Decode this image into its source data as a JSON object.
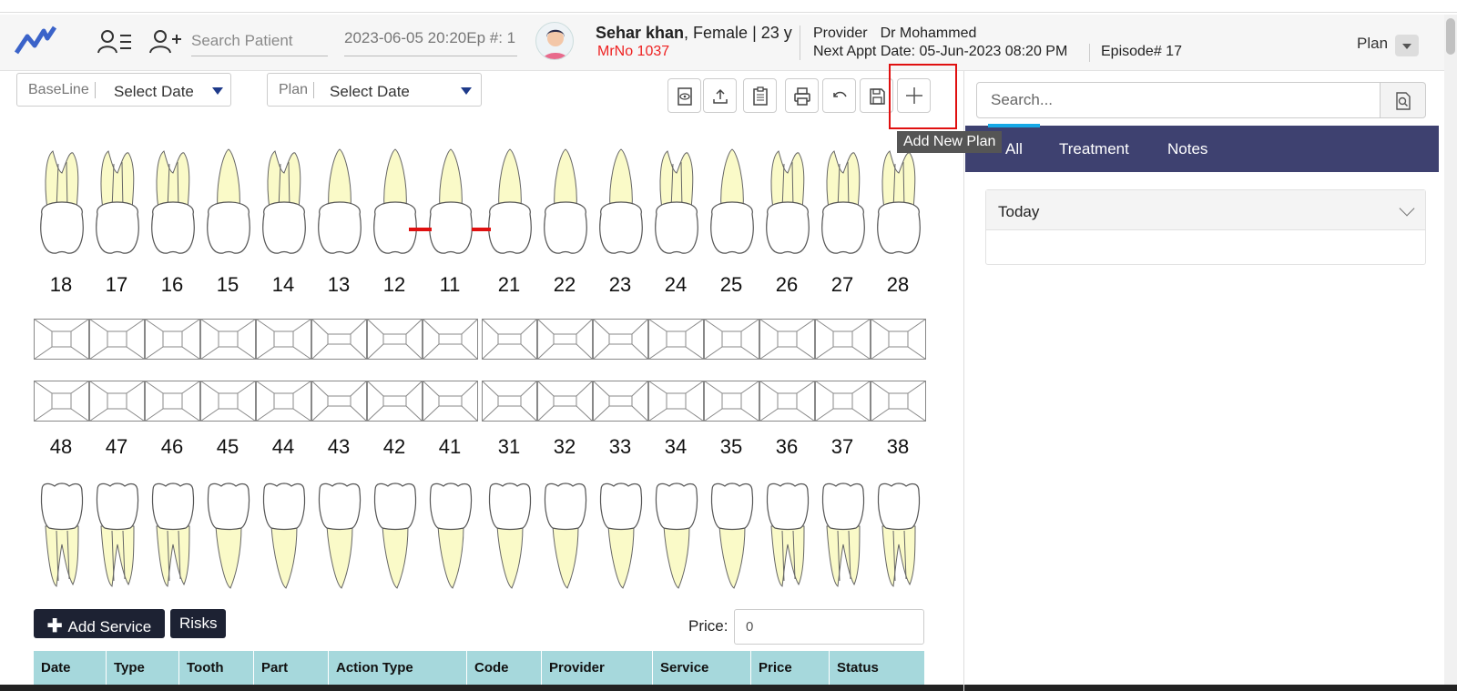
{
  "header": {
    "search_placeholder": "Search Patient",
    "episode_field": "2023-06-05 20:20Ep #: 1",
    "patient_name": "Sehar khan",
    "patient_meta": ", Female | 23 y",
    "mrno": "MrNo 1037",
    "provider_label": "Provider",
    "provider_value": "Dr Mohammed",
    "next_appt_label": "Next Appt Date:",
    "next_appt_value": "05-Jun-2023 08:20 PM",
    "episode": "Episode# 17",
    "plan_menu": "Plan"
  },
  "filters": {
    "baseline_label": "BaseLine",
    "baseline_value": "Select Date",
    "plan_label": "Plan",
    "plan_value": "Select Date"
  },
  "toolbar": {
    "tools": [
      "view-icon",
      "upload-icon",
      "clipboard-icon",
      "print-icon",
      "undo-icon",
      "save-icon",
      "plus-icon"
    ],
    "tooltip": "Add New Plan"
  },
  "chart": {
    "upper_teeth": [
      "18",
      "17",
      "16",
      "15",
      "14",
      "13",
      "12",
      "11",
      "21",
      "22",
      "23",
      "24",
      "25",
      "26",
      "27",
      "28"
    ],
    "lower_teeth": [
      "48",
      "47",
      "46",
      "45",
      "44",
      "43",
      "42",
      "41",
      "31",
      "32",
      "33",
      "34",
      "35",
      "36",
      "37",
      "38"
    ]
  },
  "bottom": {
    "add_service": "Add Service",
    "risks": "Risks",
    "price_label": "Price:",
    "price_value": "0",
    "columns": [
      "Date",
      "Type",
      "Tooth",
      "Part",
      "Action Type",
      "Code",
      "Provider",
      "Service",
      "Price",
      "Status"
    ]
  },
  "right_panel": {
    "search_placeholder": "Search...",
    "tabs": [
      "All",
      "Treatment",
      "Notes"
    ],
    "section_title": "Today"
  },
  "colors": {
    "tab_bg": "#3e4170",
    "table_header": "#a6d8dc",
    "accent_red": "#e01010",
    "root_fill": "#fafac8"
  }
}
